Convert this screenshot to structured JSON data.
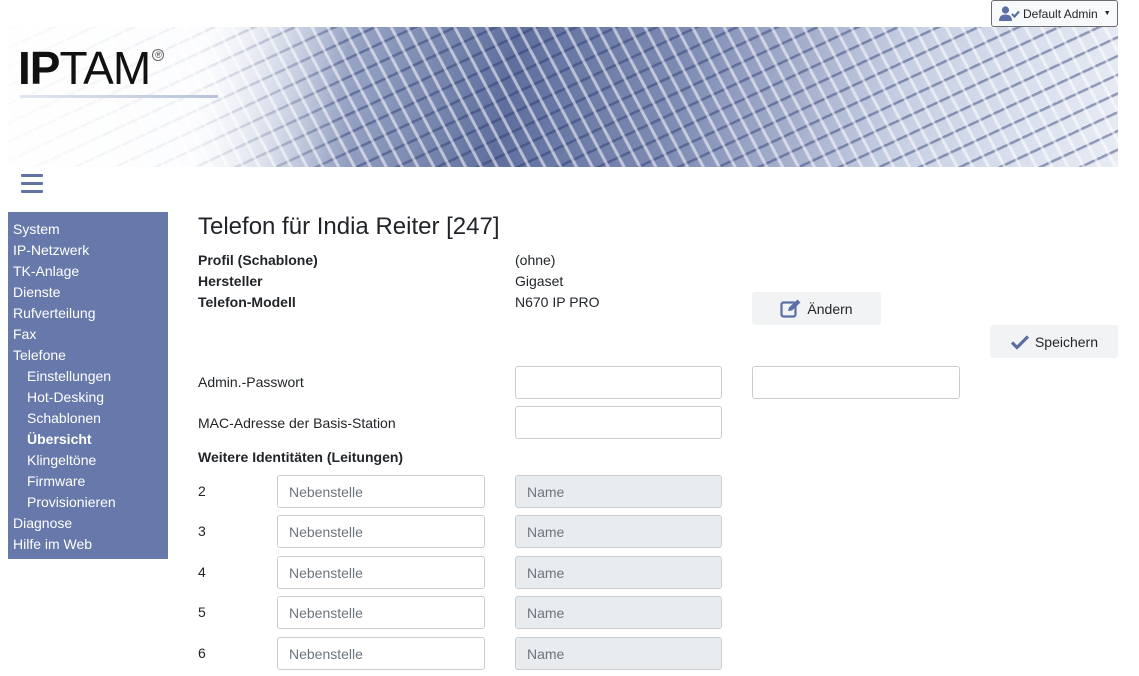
{
  "user_menu": {
    "label": "Default Admin",
    "icon": "user-check-icon"
  },
  "logo": {
    "part1": "IP",
    "part2": "TAM",
    "reg": "®"
  },
  "sidebar": {
    "items": [
      {
        "label": "System",
        "level": 0,
        "active": false
      },
      {
        "label": "IP-Netzwerk",
        "level": 0,
        "active": false
      },
      {
        "label": "TK-Anlage",
        "level": 0,
        "active": false
      },
      {
        "label": "Dienste",
        "level": 0,
        "active": false
      },
      {
        "label": "Rufverteilung",
        "level": 0,
        "active": false
      },
      {
        "label": "Fax",
        "level": 0,
        "active": false
      },
      {
        "label": "Telefone",
        "level": 0,
        "active": false
      },
      {
        "label": "Einstellungen",
        "level": 1,
        "active": false
      },
      {
        "label": "Hot-Desking",
        "level": 1,
        "active": false
      },
      {
        "label": "Schablonen",
        "level": 1,
        "active": false
      },
      {
        "label": "Übersicht",
        "level": 1,
        "active": true
      },
      {
        "label": "Klingeltöne",
        "level": 1,
        "active": false
      },
      {
        "label": "Firmware",
        "level": 1,
        "active": false
      },
      {
        "label": "Provisionieren",
        "level": 1,
        "active": false
      },
      {
        "label": "Diagnose",
        "level": 0,
        "active": false
      },
      {
        "label": "Hilfe im Web",
        "level": 0,
        "active": false
      }
    ]
  },
  "main": {
    "title": "Telefon für India Reiter [247]",
    "info": [
      {
        "label": "Profil (Schablone)",
        "value": "(ohne)"
      },
      {
        "label": "Hersteller",
        "value": "Gigaset"
      },
      {
        "label": "Telefon-Modell",
        "value": "N670 IP PRO"
      }
    ],
    "change_button": "Ändern",
    "save_button": "Speichern",
    "admin_password_label": "Admin.-Passwort",
    "admin_password_value": "",
    "admin_password_confirm_value": "",
    "mac_label": "MAC-Adresse der Basis-Station",
    "mac_value": "",
    "identities_title": "Weitere Identitäten (Leitungen)",
    "lines": [
      {
        "number": "2",
        "ext_placeholder": "Nebenstelle",
        "name_placeholder": "Name"
      },
      {
        "number": "3",
        "ext_placeholder": "Nebenstelle",
        "name_placeholder": "Name"
      },
      {
        "number": "4",
        "ext_placeholder": "Nebenstelle",
        "name_placeholder": "Name"
      },
      {
        "number": "5",
        "ext_placeholder": "Nebenstelle",
        "name_placeholder": "Name"
      },
      {
        "number": "6",
        "ext_placeholder": "Nebenstelle",
        "name_placeholder": "Name"
      }
    ]
  },
  "colors": {
    "sidebar_bg": "#6779aa",
    "accent": "#5b6fa5",
    "button_bg": "#f2f3f5"
  }
}
